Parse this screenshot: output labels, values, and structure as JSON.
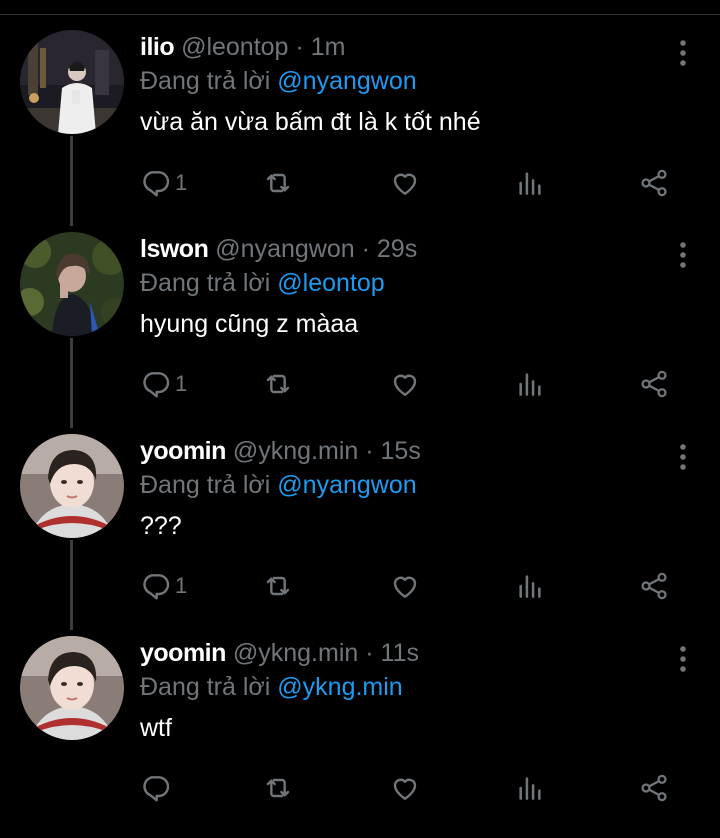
{
  "tweets": [
    {
      "display_name": "ilio",
      "handle": "@leontop",
      "time": "1m",
      "reply_prefix": "Đang trả lời",
      "reply_to": "@nyangwon",
      "text": "vừa ăn vừa bấm đt là k tốt nhé",
      "reply_count": "1",
      "avatar": "photo-night-street"
    },
    {
      "display_name": "lswon",
      "handle": "@nyangwon",
      "time": "29s",
      "reply_prefix": "Đang trả lời",
      "reply_to": "@leontop",
      "text": "hyung cũng z màaa",
      "reply_count": "1",
      "avatar": "photo-person-foliage"
    },
    {
      "display_name": "yoomin",
      "handle": "@ykng.min",
      "time": "15s",
      "reply_prefix": "Đang trả lời",
      "reply_to": "@nyangwon",
      "text": "???",
      "reply_count": "1",
      "avatar": "photo-selfie"
    },
    {
      "display_name": "yoomin",
      "handle": "@ykng.min",
      "time": "11s",
      "reply_prefix": "Đang trả lời",
      "reply_to": "@ykng.min",
      "text": "wtf",
      "reply_count": "",
      "avatar": "photo-selfie"
    }
  ],
  "icons": {
    "reply": "reply-icon",
    "retweet": "retweet-icon",
    "like": "heart-icon",
    "views": "analytics-icon",
    "share": "share-icon",
    "more": "more-vertical-icon"
  },
  "colors": {
    "background": "#000000",
    "text": "#ffffff",
    "secondary": "#71767b",
    "mention": "#1d9bf0",
    "thread_line": "#3a3e42"
  }
}
